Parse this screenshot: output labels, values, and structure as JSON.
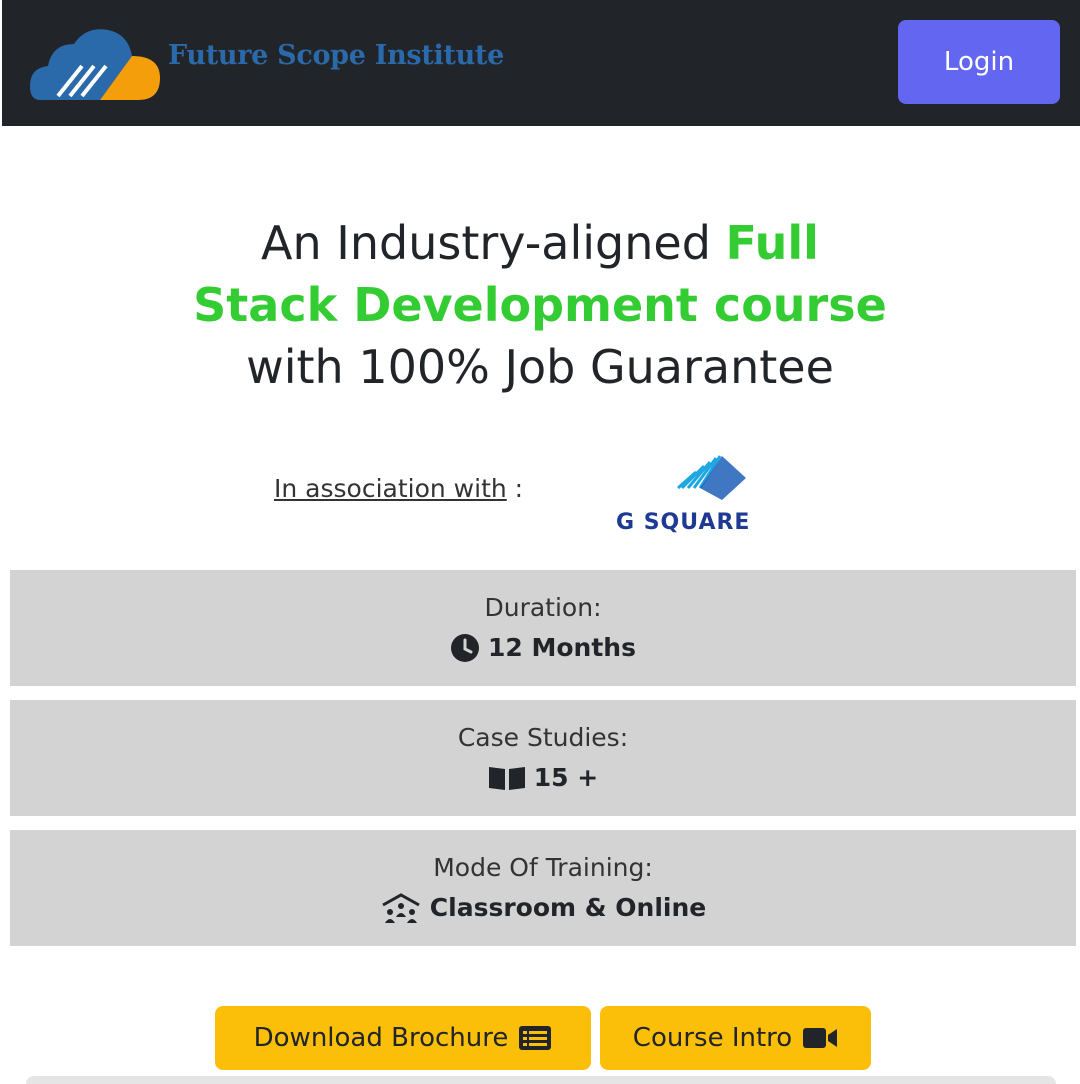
{
  "header": {
    "brand_name": "Future Scope Institute",
    "login_label": "Login",
    "brand_colors": {
      "cloud_blue": "#2a6aab",
      "cloud_orange": "#f59e0b"
    }
  },
  "hero": {
    "line1_plain": "An Industry-aligned ",
    "line1_highlight": "Full",
    "line2_highlight": "Stack Development course",
    "line3_plain": "with 100% Job Guarantee",
    "highlight_color": "#33cc33"
  },
  "association": {
    "label": "In association with",
    "separator": " :",
    "partner_name": "G SQUARE"
  },
  "info": [
    {
      "label": "Duration:",
      "value": "12 Months",
      "icon": "clock-icon"
    },
    {
      "label": "Case Studies:",
      "value": "15 +",
      "icon": "book-open-icon"
    },
    {
      "label": "Mode Of Training:",
      "value": "Classroom & Online",
      "icon": "chalkboard-teacher-icon"
    }
  ],
  "actions": {
    "brochure_label": "Download Brochure",
    "brochure_icon": "list-card-icon",
    "intro_label": "Course Intro",
    "intro_icon": "video-camera-icon",
    "button_color": "#fbbf0a"
  }
}
